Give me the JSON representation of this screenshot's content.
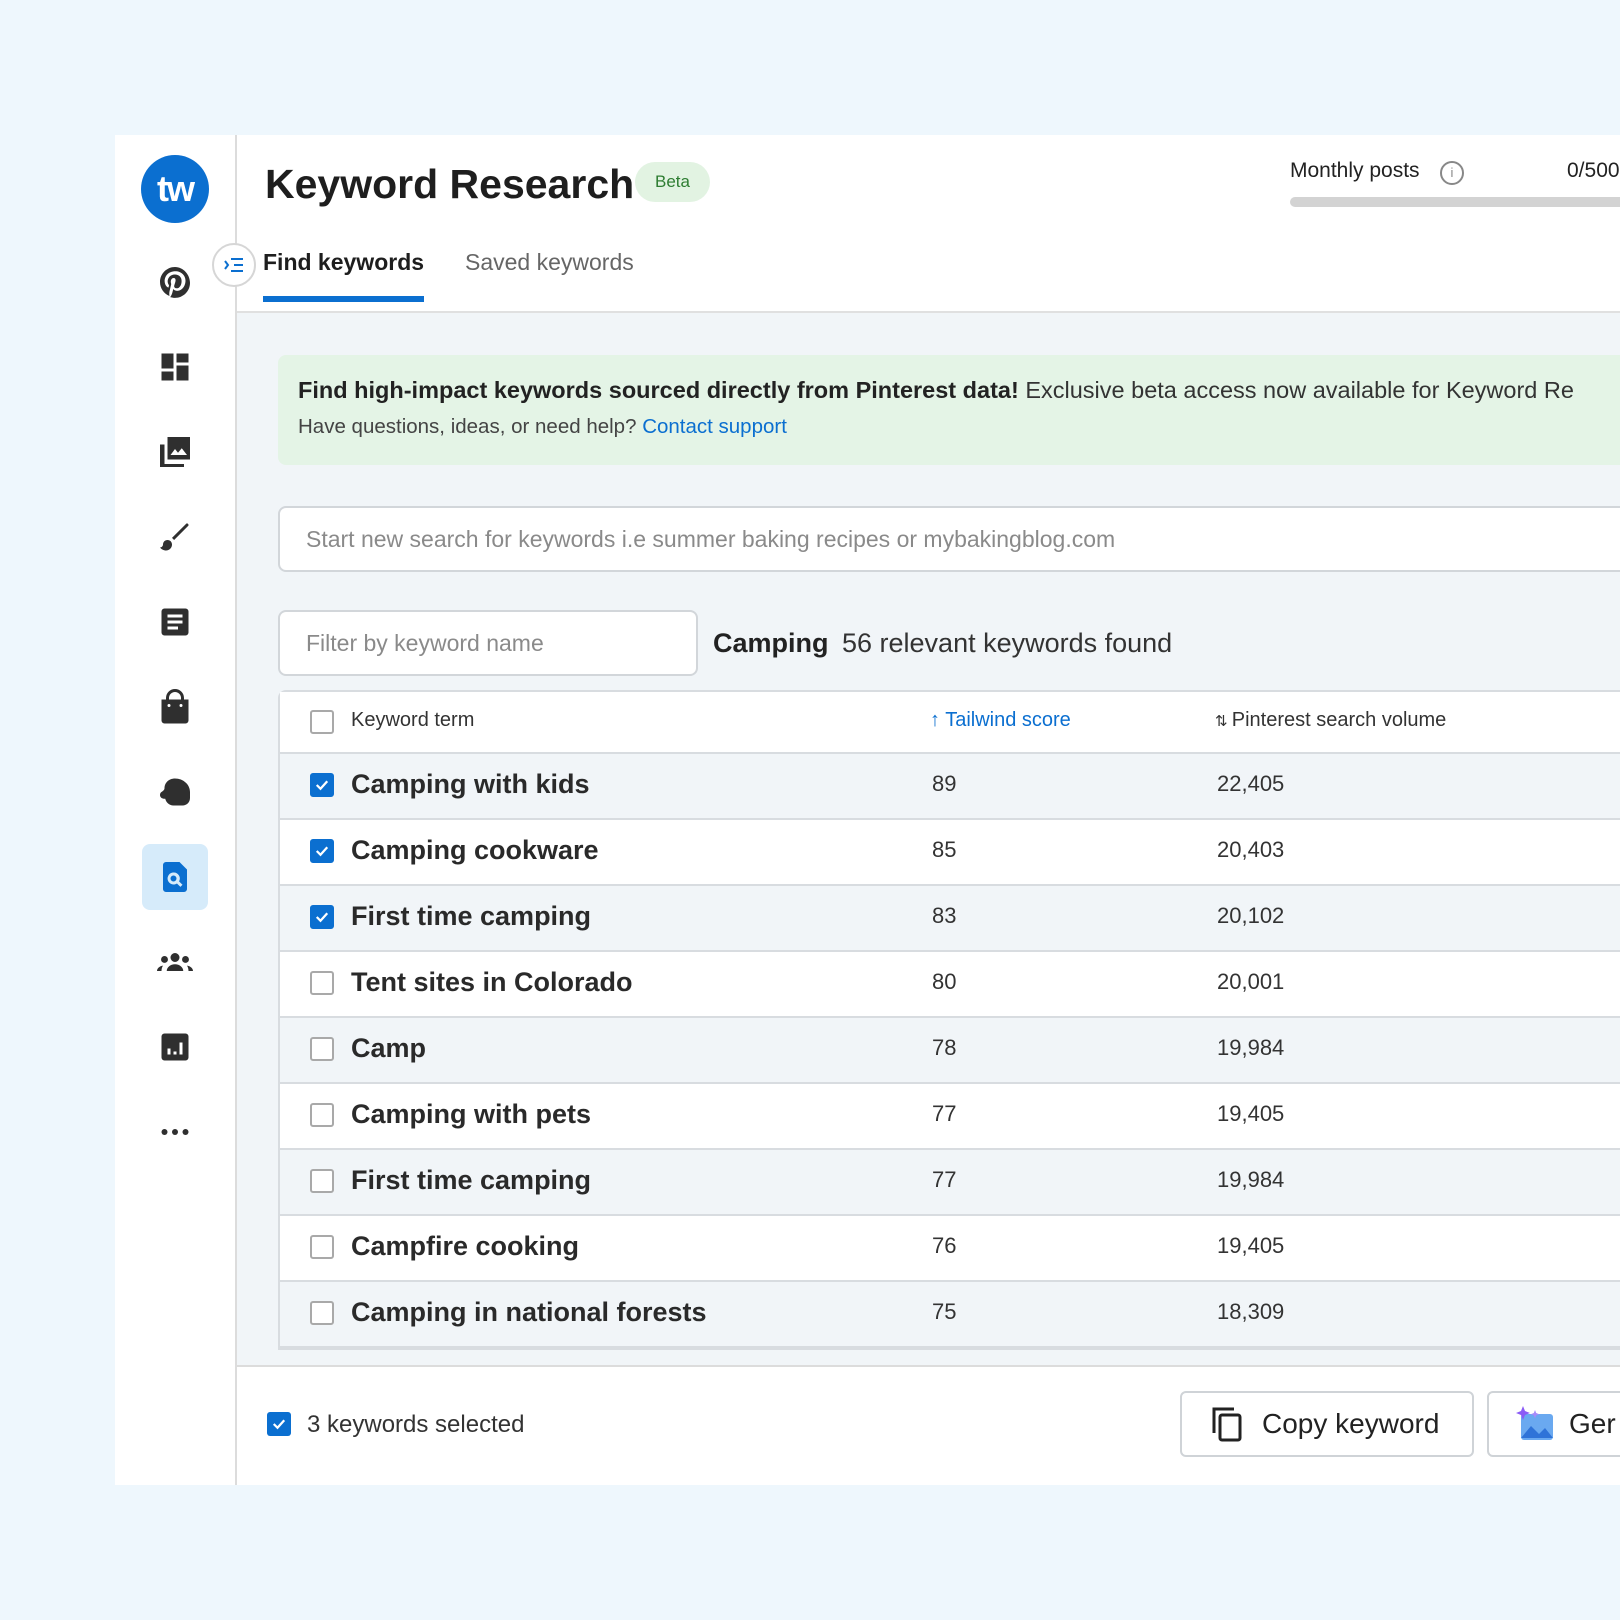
{
  "sidebar": {
    "logo_text": "tw",
    "items": [
      {
        "icon": "pinterest-icon"
      },
      {
        "icon": "dashboard-icon"
      },
      {
        "icon": "gallery-icon"
      },
      {
        "icon": "brush-icon"
      },
      {
        "icon": "document-icon"
      },
      {
        "icon": "shopping-bag-icon"
      },
      {
        "icon": "community-icon"
      },
      {
        "icon": "keyword-search-icon",
        "active": true
      },
      {
        "icon": "people-icon"
      },
      {
        "icon": "analytics-icon"
      },
      {
        "icon": "more-icon"
      }
    ]
  },
  "header": {
    "title": "Keyword Research",
    "badge": "Beta",
    "monthly_label": "Monthly posts",
    "monthly_count": "0/500",
    "monthly_progress": 0
  },
  "tabs": [
    {
      "label": "Find keywords",
      "active": true
    },
    {
      "label": "Saved keywords",
      "active": false
    }
  ],
  "banner": {
    "bold": "Find high-impact keywords sourced directly from Pinterest data!",
    "text": " Exclusive beta access now available for Keyword Re",
    "help_text": "Have questions, ideas, or need help? ",
    "link": "Contact support"
  },
  "search": {
    "placeholder": "Start new search for keywords i.e summer baking recipes or mybakingblog.com",
    "value": ""
  },
  "filter": {
    "placeholder": "Filter by keyword name",
    "value": ""
  },
  "results": {
    "query": "Camping",
    "count_text": "56 relevant keywords found"
  },
  "table": {
    "headers": {
      "term": "Keyword term",
      "score": "Tailwind score",
      "volume": "Pinterest search volume"
    },
    "rows": [
      {
        "term": "Camping with kids",
        "score": "89",
        "volume": "22,405",
        "checked": true
      },
      {
        "term": "Camping cookware",
        "score": "85",
        "volume": "20,403",
        "checked": true
      },
      {
        "term": "First time camping",
        "score": "83",
        "volume": "20,102",
        "checked": true
      },
      {
        "term": "Tent sites in Colorado",
        "score": "80",
        "volume": "20,001",
        "checked": false
      },
      {
        "term": "Camp",
        "score": "78",
        "volume": "19,984",
        "checked": false
      },
      {
        "term": "Camping with pets",
        "score": "77",
        "volume": "19,405",
        "checked": false
      },
      {
        "term": "First time camping",
        "score": "77",
        "volume": "19,984",
        "checked": false
      },
      {
        "term": "Campfire cooking",
        "score": "76",
        "volume": "19,405",
        "checked": false
      },
      {
        "term": "Camping in national forests",
        "score": "75",
        "volume": "18,309",
        "checked": false
      }
    ]
  },
  "footer": {
    "selected_text": "3 keywords selected",
    "copy_label": "Copy keyword",
    "generate_label": "Ger"
  },
  "colors": {
    "accent": "#0b6fd0",
    "page_bg": "#eef7fd",
    "banner_bg": "#e4f4e6",
    "active_nav_bg": "#d6ebfa"
  }
}
